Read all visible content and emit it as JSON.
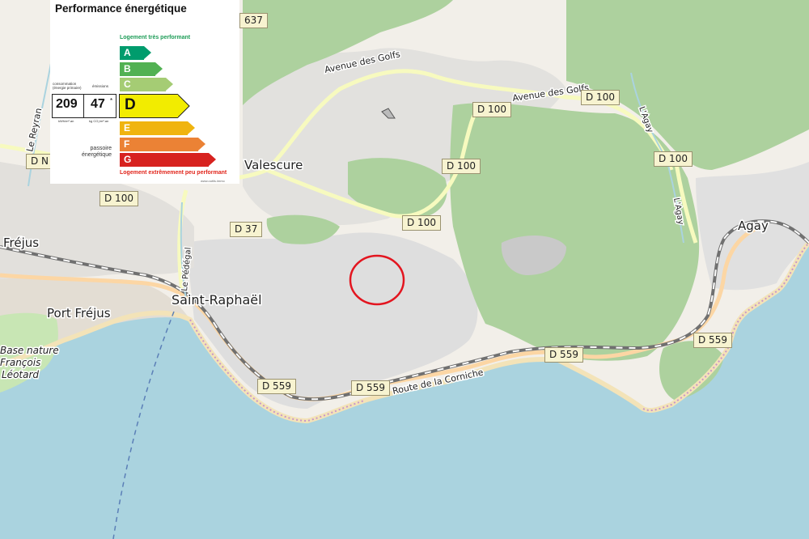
{
  "map": {
    "places": {
      "frejus": "Fréjus",
      "port_frejus": "Port Fréjus",
      "saint_raphael": "Saint-Raphaël",
      "valescure": "Valescure",
      "agay": "Agay",
      "base_nature_1": "Base nature",
      "base_nature_2": "François",
      "base_nature_3": "Léotard"
    },
    "street_labels": {
      "avenue_golfs_1": "Avenue des Golfs",
      "avenue_golfs_2": "Avenue des Golfs",
      "route_corniche": "Route de la Corniche",
      "le_reyran": "Le Reyran",
      "le_pedegal": "Le Pédégal",
      "l_agay_1": "L'Agay",
      "l_agay_2": "L'Agay"
    },
    "road_shields": {
      "r637": "637",
      "d100_a": "D 100",
      "d100_b": "D 100",
      "d100_c": "D 100",
      "d100_d": "D 100",
      "d100_e": "D 100",
      "d100_f": "D 100",
      "dn_partial": "D N",
      "d37": "D 37",
      "d559_a": "D 559",
      "d559_b": "D 559",
      "d559_c": "D 559",
      "d559_d": "D 559"
    },
    "marker": {
      "shape": "circle",
      "color": "#e3151f"
    },
    "colors": {
      "sea": "#aad3df",
      "forest": "#add19e",
      "urban": "#dddddd",
      "beach": "#f5e9c6",
      "road_yellow": "#f7fabf",
      "road_orange": "#fcd6a4",
      "railway": "#707070"
    }
  },
  "dpe": {
    "title": "Performance énergétique",
    "top_note": "Logement très performant",
    "bottom_note": "Logement extrêmement peu performant",
    "consumption_label": "consommation (énergie primaire)",
    "emissions_label": "émissions",
    "consumption_value": "209",
    "consumption_unit": "kWh/m².an",
    "emissions_value": "47",
    "emissions_star": "*",
    "emissions_unit": "kg CO₂/m².an",
    "passoire_label": "passoire énergétique",
    "source_url": "www.outils.immo",
    "current_class": "D",
    "classes": [
      {
        "letter": "A",
        "color": "#009c6d"
      },
      {
        "letter": "B",
        "color": "#52b153"
      },
      {
        "letter": "C",
        "color": "#a5cc74"
      },
      {
        "letter": "D",
        "color": "#f2ec00"
      },
      {
        "letter": "E",
        "color": "#f0b40f"
      },
      {
        "letter": "F",
        "color": "#eb8235"
      },
      {
        "letter": "G",
        "color": "#d7221f"
      }
    ]
  }
}
